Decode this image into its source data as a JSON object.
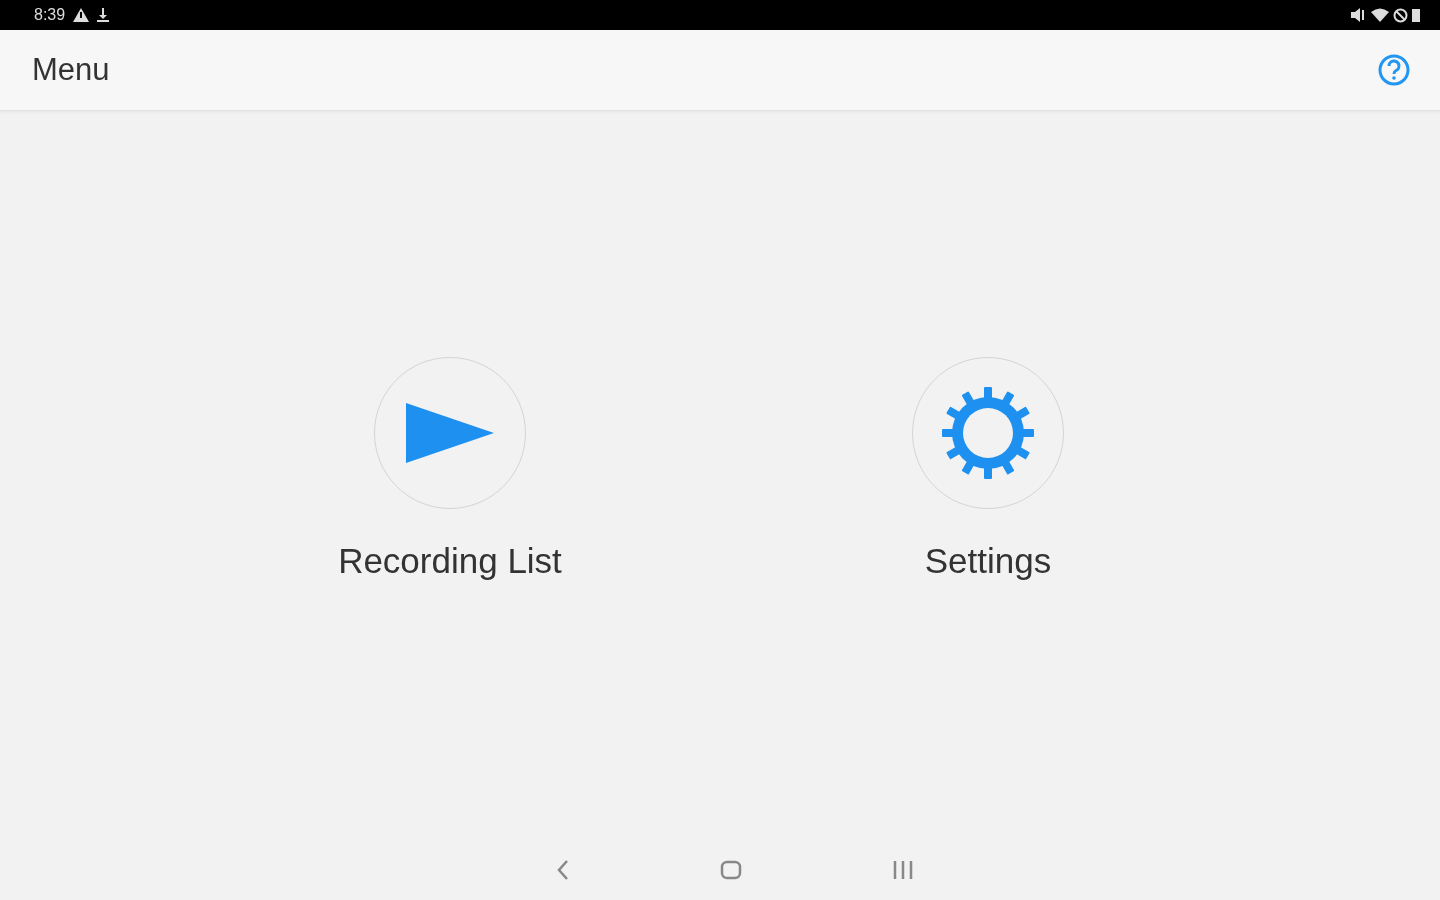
{
  "status_bar": {
    "time": "8:39"
  },
  "app_bar": {
    "title": "Menu"
  },
  "menu_items": [
    {
      "kind": "play",
      "label": "Recording List"
    },
    {
      "kind": "settings",
      "label": "Settings"
    }
  ]
}
